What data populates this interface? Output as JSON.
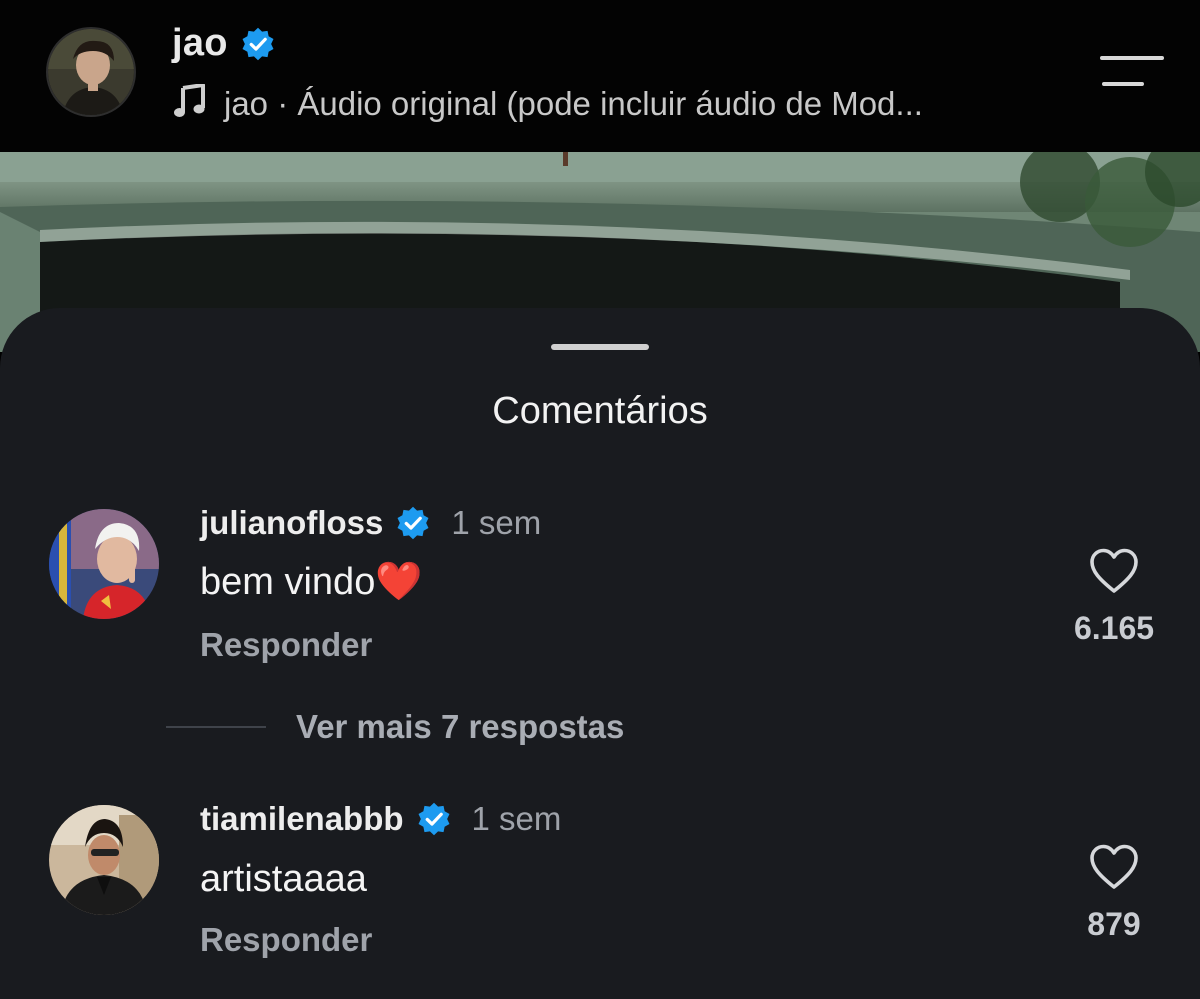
{
  "header": {
    "username": "jao",
    "verified": true,
    "audio_text": "jao · Áudio original (pode incluir áudio de Mod...",
    "icons": {
      "avatar": "profile-avatar",
      "verified": "verified-badge-icon",
      "audio": "music-note-icon",
      "menu": "menu-icon"
    }
  },
  "sheet": {
    "title": "Comentários"
  },
  "comments": [
    {
      "username": "julianofloss",
      "verified": true,
      "time": "1 sem",
      "text": "bem vindo",
      "emoji": "❤️",
      "reply_label": "Responder",
      "likes": "6.165"
    },
    {
      "username": "tiamilenabbb",
      "verified": true,
      "time": "1 sem",
      "text": "artistaaaa",
      "reply_label": "Responder",
      "likes": "879"
    }
  ],
  "more_replies": {
    "label": "Ver mais 7 respostas"
  },
  "colors": {
    "sheet_bg": "#191b1f",
    "verified_blue": "#1d9bf0",
    "muted_text": "#9fa3aa"
  }
}
